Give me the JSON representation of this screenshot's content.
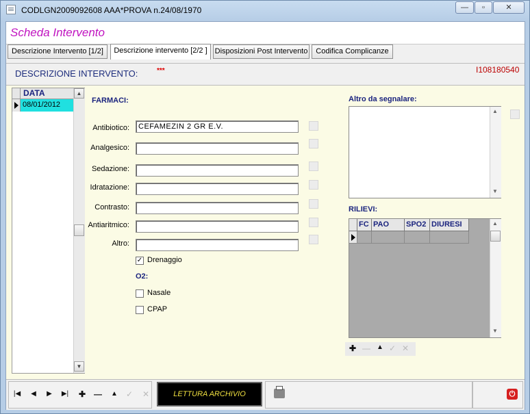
{
  "window": {
    "title": "CODLGN2009092608 AAA*PROVA n.24/08/1970",
    "minimize": "—",
    "maximize": "▫",
    "close": "✕"
  },
  "header": {
    "title": "Scheda Intervento"
  },
  "tabs": [
    {
      "label": "Descrizione Intervento [1/2]",
      "active": false
    },
    {
      "label": "Descrizione intervento [2/2 ]",
      "active": true
    },
    {
      "label": "Disposizioni Post Intervento",
      "active": false
    },
    {
      "label": "Codifica Complicanze",
      "active": false
    }
  ],
  "description": {
    "label": "DESCRIZIONE INTERVENTO:",
    "stars": "***",
    "code": "I108180540"
  },
  "date_grid": {
    "header": "DATA",
    "rows": [
      "08/01/2012"
    ]
  },
  "farmaci": {
    "section_label": "FARMACI:",
    "fields": [
      {
        "label": "Antibiotico:",
        "value": "CEFAMEZIN 2 GR E.V."
      },
      {
        "label": "Analgesico:",
        "value": ""
      },
      {
        "label": "Sedazione:",
        "value": ""
      },
      {
        "label": "Idratazione:",
        "value": ""
      },
      {
        "label": "Contrasto:",
        "value": ""
      },
      {
        "label": "Antiaritmico:",
        "value": ""
      },
      {
        "label": "Altro:",
        "value": ""
      }
    ],
    "drenaggio": {
      "label": "Drenaggio",
      "checked": true
    },
    "o2_label": "O2:",
    "nasale": {
      "label": "Nasale",
      "checked": false
    },
    "cpap": {
      "label": "CPAP",
      "checked": false
    }
  },
  "altro": {
    "label": "Altro da segnalare:",
    "value": ""
  },
  "rilievi": {
    "label": "RILIEVI:",
    "columns": [
      "FC",
      "PAO",
      "SPO2",
      "DIURESI"
    ]
  },
  "bottom": {
    "lettura_label": "LETTURA ARCHIVIO"
  },
  "icons": {
    "nav": [
      "first-record-icon",
      "prev-record-icon",
      "next-record-icon",
      "last-record-icon",
      "add-icon",
      "delete-icon",
      "move-up-icon",
      "confirm-icon",
      "cancel-icon"
    ],
    "print": "printer-icon",
    "exit": "power-icon"
  },
  "colors": {
    "title_magenta": "#c013c0",
    "selected_cell": "#20e0e0",
    "panel_bg": "#fbfbe5",
    "lettura_text": "#f0e040"
  }
}
